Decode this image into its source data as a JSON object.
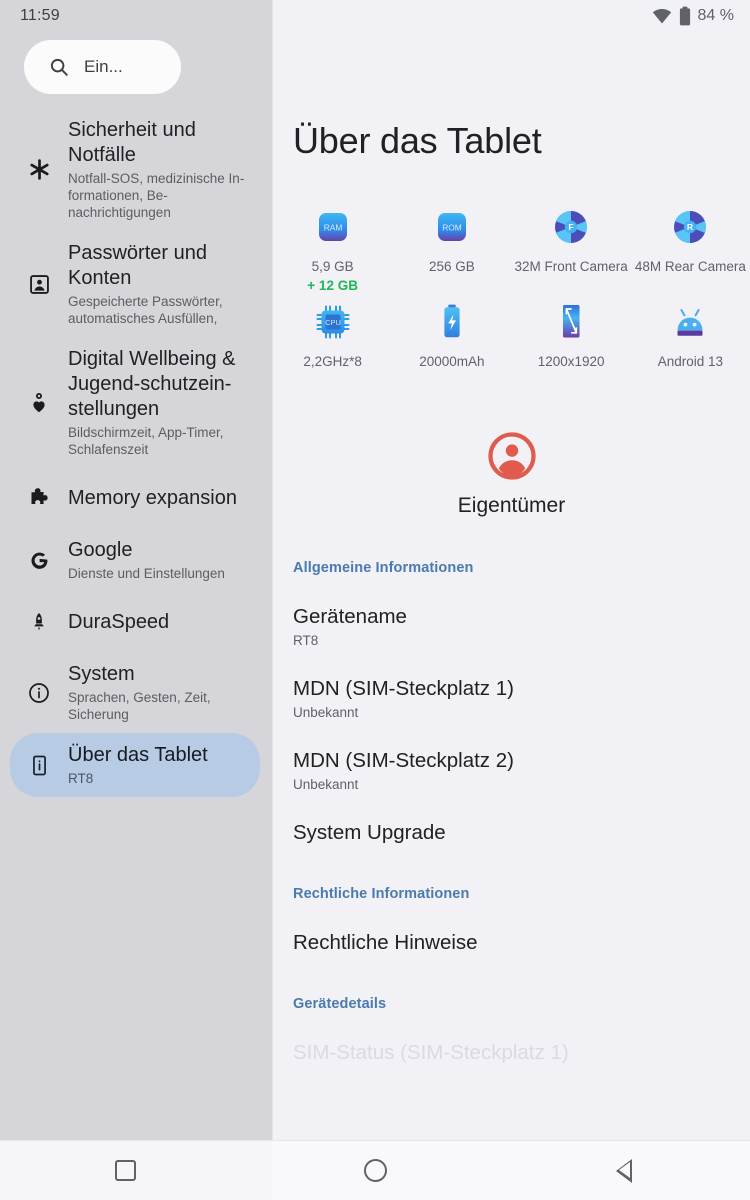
{
  "status_bar": {
    "time": "11:59",
    "battery_percent": "84 %",
    "wifi_icon": "wifi-icon",
    "battery_icon": "battery-icon"
  },
  "search": {
    "placeholder": "Ein...",
    "icon": "search-icon"
  },
  "sidebar": {
    "items": [
      {
        "id": "security",
        "icon": "asterisk-icon",
        "title": "Sicherheit und Notfälle",
        "subtitle": "Notfall-SOS, medizinische In-formationen, Be-nachrichtigungen",
        "selected": false
      },
      {
        "id": "passwords",
        "icon": "account-box-icon",
        "title": "Passwörter und Konten",
        "subtitle": "Gespeicherte Passwörter, automatisches Ausfüllen,",
        "selected": false
      },
      {
        "id": "digital-wellbeing",
        "icon": "wellbeing-heart-icon",
        "title": "Digital Wellbeing & Jugend-schutzein-stellungen",
        "subtitle": "Bildschirmzeit, App-Timer, Schlafenszeit",
        "selected": false
      },
      {
        "id": "memory-expansion",
        "icon": "puzzle-piece-icon",
        "title": "Memory expansion",
        "subtitle": "",
        "selected": false
      },
      {
        "id": "google",
        "icon": "google-g-icon",
        "title": "Google",
        "subtitle": "Dienste und Einstellungen",
        "selected": false
      },
      {
        "id": "duraspeed",
        "icon": "rocket-icon",
        "title": "DuraSpeed",
        "subtitle": "",
        "selected": false
      },
      {
        "id": "system",
        "icon": "info-circle-icon",
        "title": "System",
        "subtitle": "Sprachen, Gesten, Zeit, Sicherung",
        "selected": false
      },
      {
        "id": "about-tablet",
        "icon": "tablet-info-icon",
        "title": "Über das Tablet",
        "subtitle": "RT8",
        "selected": true
      }
    ]
  },
  "main": {
    "title": "Über das Tablet",
    "specs": [
      {
        "id": "ram",
        "icon": "ram-chip-icon",
        "label": "5,9 GB",
        "bonus": "+ 12 GB"
      },
      {
        "id": "rom",
        "icon": "rom-chip-icon",
        "label": "256 GB",
        "bonus": ""
      },
      {
        "id": "front-camera",
        "icon": "aperture-front-icon",
        "label": "32M Front Camera",
        "bonus": ""
      },
      {
        "id": "rear-camera",
        "icon": "aperture-rear-icon",
        "label": "48M Rear Camera",
        "bonus": ""
      },
      {
        "id": "cpu",
        "icon": "cpu-chip-icon",
        "label": "2,2GHz*8",
        "bonus": ""
      },
      {
        "id": "battery",
        "icon": "battery-bolt-icon",
        "label": "20000mAh",
        "bonus": ""
      },
      {
        "id": "display",
        "icon": "screen-size-icon",
        "label": "1200x1920",
        "bonus": ""
      },
      {
        "id": "os",
        "icon": "android-robot-icon",
        "label": "Android 13",
        "bonus": ""
      }
    ],
    "owner": {
      "avatar_icon": "account-circle-icon",
      "avatar_color": "#e05a4e",
      "name": "Eigentümer"
    },
    "sections": [
      {
        "id": "general",
        "heading": "Allgemeine Informationen",
        "rows": [
          {
            "id": "device-name",
            "title": "Gerätename",
            "subtitle": "RT8"
          },
          {
            "id": "mdn-sim-1",
            "title": "MDN (SIM-Steckplatz 1)",
            "subtitle": "Unbekannt"
          },
          {
            "id": "mdn-sim-2",
            "title": "MDN (SIM-Steckplatz 2)",
            "subtitle": "Unbekannt"
          },
          {
            "id": "system-upgrade",
            "title": "System Upgrade",
            "subtitle": ""
          }
        ]
      },
      {
        "id": "legal",
        "heading": "Rechtliche Informationen",
        "rows": [
          {
            "id": "legal-notices",
            "title": "Rechtliche Hinweise",
            "subtitle": ""
          }
        ]
      },
      {
        "id": "device-details",
        "heading": "Gerätedetails",
        "rows": [
          {
            "id": "sim-status-1",
            "title": "SIM-Status (SIM-Steckplatz 1)",
            "subtitle": ""
          }
        ]
      }
    ]
  },
  "navbar": {
    "recents_label": "recent-apps",
    "home_label": "home",
    "back_label": "back"
  },
  "colors": {
    "sidebar_bg": "#d6d6da",
    "main_bg": "#f1f1f6",
    "selected_pill": "#b8cbe4",
    "section_heading": "#4a7ab0",
    "bonus_green": "#1db954"
  }
}
